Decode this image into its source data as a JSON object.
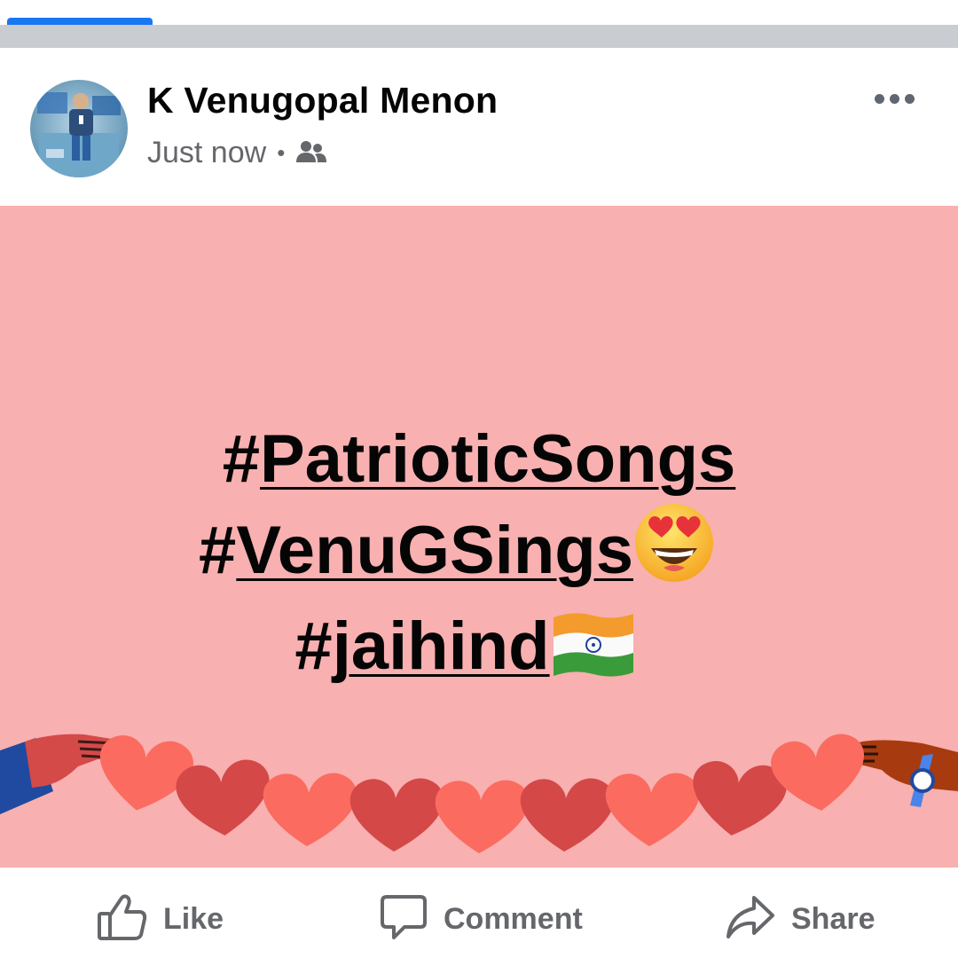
{
  "post": {
    "author": "K Venugopal Menon",
    "timestamp": "Just now",
    "separator": "•",
    "audience_icon": "friends-icon",
    "more_icon": "more-horizontal-icon",
    "background_color": "#f8b0b0",
    "hashtags": [
      {
        "hash": "#",
        "word": "PatrioticSongs",
        "emoji": ""
      },
      {
        "hash": "#",
        "word": "VenuGSings",
        "emoji": "heart-eyes-emoji"
      },
      {
        "hash": "#",
        "word": "jaihind",
        "emoji": "india-flag-emoji"
      }
    ]
  },
  "actions": {
    "like": {
      "label": "Like",
      "icon": "thumbs-up-icon"
    },
    "comment": {
      "label": "Comment",
      "icon": "comment-bubble-icon"
    },
    "share": {
      "label": "Share",
      "icon": "share-arrow-icon"
    }
  },
  "colors": {
    "accent": "#1877f2",
    "secondary_text": "#65676b",
    "primary_text": "#050505",
    "divider": "#c9ccd1"
  }
}
